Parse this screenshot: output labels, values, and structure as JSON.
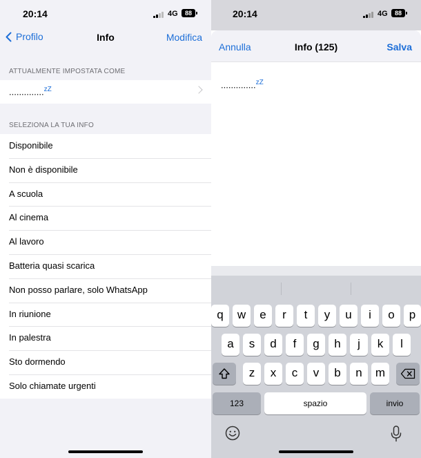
{
  "left": {
    "status": {
      "time": "20:14",
      "network": "4G",
      "battery": "88"
    },
    "nav": {
      "back_label": "Profilo",
      "title": "Info",
      "edit_label": "Modifica"
    },
    "current_header": "ATTUALMENTE IMPOSTATA COME",
    "current_value": "..............",
    "current_value_suffix": "zZ",
    "select_header": "SELEZIONA LA TUA INFO",
    "items": [
      "Disponibile",
      "Non è disponibile",
      "A scuola",
      "Al cinema",
      "Al lavoro",
      "Batteria quasi scarica",
      "Non posso parlare, solo WhatsApp",
      "In riunione",
      "In palestra",
      "Sto dormendo",
      "Solo chiamate urgenti"
    ]
  },
  "right": {
    "status": {
      "time": "20:14",
      "network": "4G",
      "battery": "88"
    },
    "nav": {
      "cancel_label": "Annulla",
      "title": "Info (125)",
      "save_label": "Salva"
    },
    "text_value": "..............",
    "text_value_suffix": "zZ",
    "keyboard": {
      "row1": [
        "q",
        "w",
        "e",
        "r",
        "t",
        "y",
        "u",
        "i",
        "o",
        "p"
      ],
      "row2": [
        "a",
        "s",
        "d",
        "f",
        "g",
        "h",
        "j",
        "k",
        "l"
      ],
      "row3": [
        "z",
        "x",
        "c",
        "v",
        "b",
        "n",
        "m"
      ],
      "numbers_label": "123",
      "space_label": "spazio",
      "return_label": "invio"
    }
  },
  "colors": {
    "accent": "#1c6ed8",
    "grouped_bg": "#f2f2f7",
    "keyboard_bg": "#d1d3d9"
  }
}
